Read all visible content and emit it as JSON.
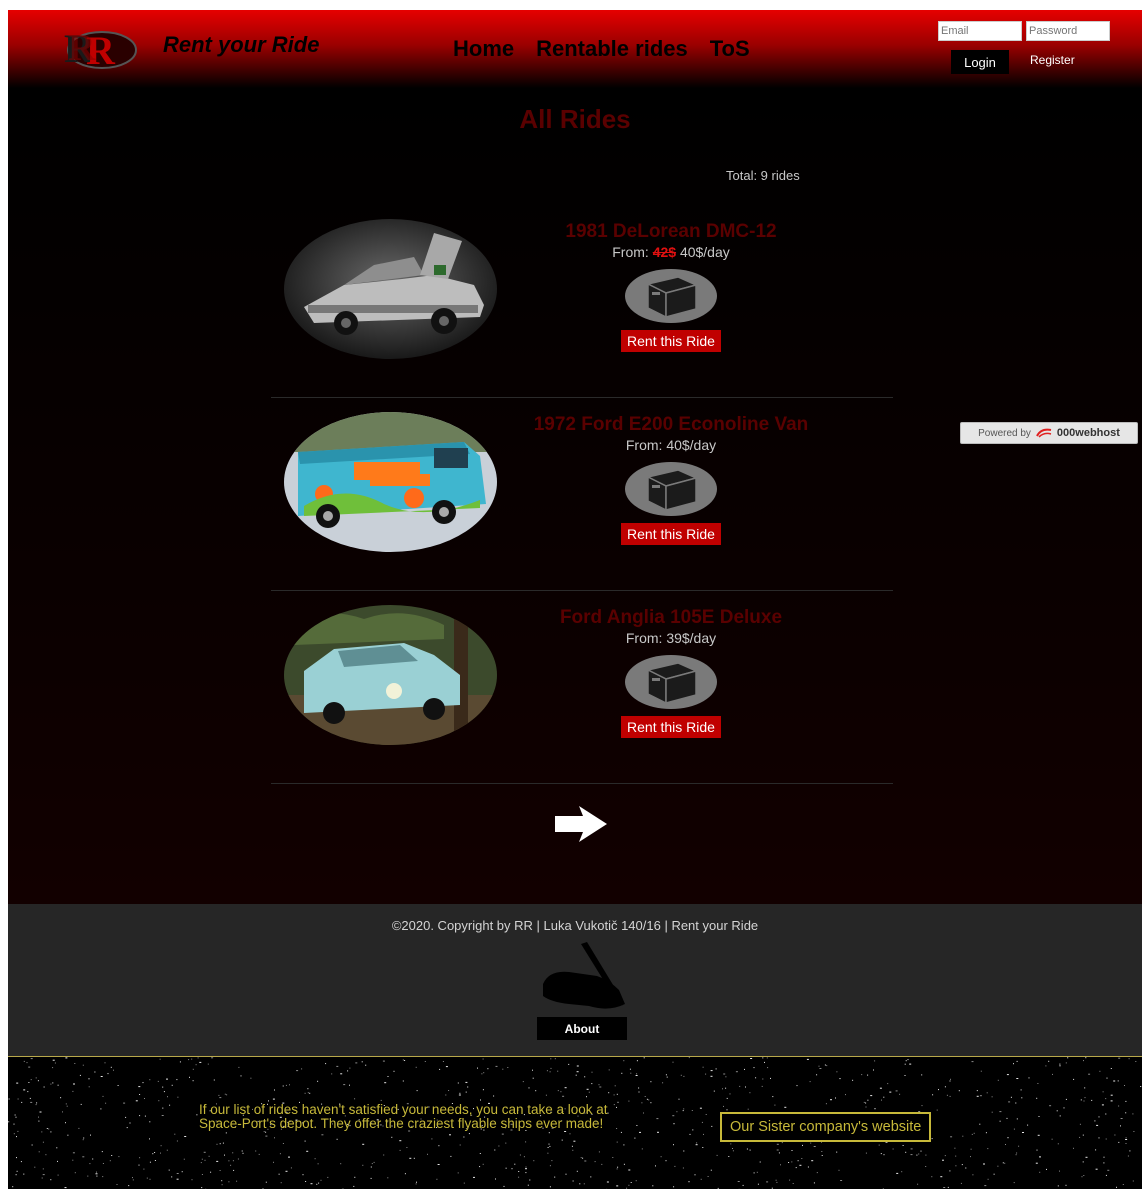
{
  "header": {
    "brand": "Rent your Ride",
    "nav": [
      {
        "label": "Home"
      },
      {
        "label": "Rentable rides"
      },
      {
        "label": "ToS"
      }
    ],
    "email_placeholder": "Email",
    "password_placeholder": "Password",
    "login_label": "Login",
    "register_label": "Register"
  },
  "main": {
    "title": "All Rides",
    "total": "Total: 9 rides",
    "rides": [
      {
        "name": "1981 DeLorean DMC-12",
        "from_label": "From:",
        "old_price": "42$",
        "price": "40$/day",
        "button": "Rent this Ride"
      },
      {
        "name": "1972 Ford E200 Econoline Van",
        "from_label": "From:",
        "price": "40$/day",
        "button": "Rent this Ride"
      },
      {
        "name": "Ford Anglia 105E Deluxe",
        "from_label": "From:",
        "price": "39$/day",
        "button": "Rent this Ride"
      }
    ]
  },
  "hosting_badge": {
    "prefix": "Powered by",
    "name": "000webhost"
  },
  "footer": {
    "copyright": "©2020. Copyright by RR | Luka Vukotič 140/16 | Rent your Ride",
    "about_label": "About"
  },
  "sister": {
    "text": "If our list of rides haven't satisfied your needs, you can take a look at Space-Port's depot. They offer the craziest flyable ships ever made!",
    "button_label": "Our Sister company's website"
  },
  "colors": {
    "header_red": "#e60000",
    "title_red": "#5a0000",
    "button_red": "#c00000",
    "sister_gold": "#c7b93a",
    "footer_bg": "#262626"
  }
}
